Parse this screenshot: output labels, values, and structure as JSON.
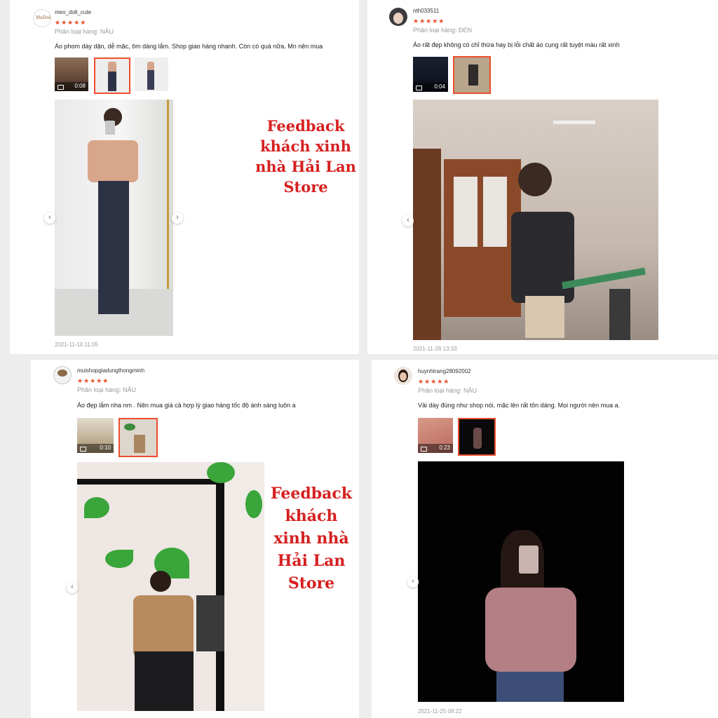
{
  "overlay_lines": [
    "Feedback",
    "khách xinh",
    "nhà Hải Lan",
    "Store"
  ],
  "overlay_lines_alt": [
    "Feedback",
    "khách",
    "xinh nhà",
    "Hải Lan",
    "Store"
  ],
  "colors": {
    "accent": "#ee4d2d",
    "overlay_text": "#d62020"
  },
  "reviews": [
    {
      "username": "meo_doll_cute",
      "stars": "★★★★★",
      "rating": 5,
      "variant": "Phân loại hàng: NÂU",
      "comment": "Áo phom dày dặn, dễ mặc, ôm dáng lắm. Shop giao hàng nhanh. Còn có quà nữa. Mn nên mua",
      "video_duration": "0:08",
      "timestamp": "2021-11-10 11:05"
    },
    {
      "username": "nth033511",
      "stars": "★★★★★",
      "rating": 5,
      "variant": "Phân loại hàng: ĐEN",
      "comment": "Áo rất đẹp không có chỉ thừa hay bị lỗi chất áo cụng rất tuyệt màu rất xinh",
      "video_duration": "0:04",
      "timestamp": "2021-11-28 13:33"
    },
    {
      "username": "muishopgiadungthongminh",
      "stars": "★★★★★",
      "rating": 5,
      "variant": "Phân loại hàng: NÂU",
      "comment": "Áo đẹp lắm nha nm . Nên mua giá cả hợp lý giao hàng tốc độ ánh sáng luôn a",
      "video_duration": "0:10",
      "timestamp": ""
    },
    {
      "username": "huynhtrang28092002",
      "stars": "★★★★★",
      "rating": 5,
      "variant": "Phân loại hàng: NÂU",
      "comment": "Vải dày đúng như shop nói, mặc lên rất tôn dáng. Mọi người nên mua a.",
      "video_duration": "0:23",
      "timestamp": "2021-11-25 08:22"
    }
  ],
  "nav": {
    "prev": "‹",
    "next": "›"
  }
}
